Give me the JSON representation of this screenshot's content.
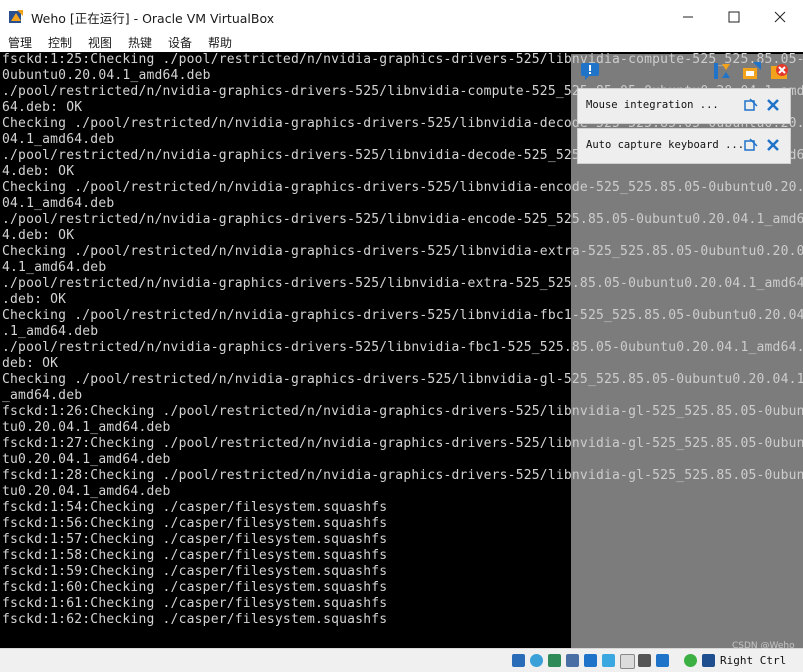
{
  "window": {
    "title": "Weho [正在运行] - Oracle VM VirtualBox",
    "app_icon": "virtualbox-icon",
    "controls": [
      "minimize-icon",
      "maximize-icon",
      "close-icon"
    ]
  },
  "menu": [
    "管理",
    "控制",
    "视图",
    "热键",
    "设备",
    "帮助"
  ],
  "console": {
    "lines": [
      "fsckd:1:25:Checking ./pool/restricted/n/nvidia-graphics-drivers-525/libnvidia-compute-525_525.85.05-",
      "0ubuntu0.20.04.1_amd64.deb",
      "./pool/restricted/n/nvidia-graphics-drivers-525/libnvidia-compute-525_525.85.05-0ubuntu0.20.04.1_amd",
      "64.deb: OK",
      "Checking ./pool/restricted/n/nvidia-graphics-drivers-525/libnvidia-decode-525_525.85.05-0ubuntu0.20.",
      "04.1_amd64.deb",
      "./pool/restricted/n/nvidia-graphics-drivers-525/libnvidia-decode-525_525.85.05-0ubuntu0.20.04.1_amd6",
      "4.deb: OK",
      "Checking ./pool/restricted/n/nvidia-graphics-drivers-525/libnvidia-encode-525_525.85.05-0ubuntu0.20.",
      "04.1_amd64.deb",
      "./pool/restricted/n/nvidia-graphics-drivers-525/libnvidia-encode-525_525.85.05-0ubuntu0.20.04.1_amd6",
      "4.deb: OK",
      "Checking ./pool/restricted/n/nvidia-graphics-drivers-525/libnvidia-extra-525_525.85.05-0ubuntu0.20.0",
      "4.1_amd64.deb",
      "./pool/restricted/n/nvidia-graphics-drivers-525/libnvidia-extra-525_525.85.05-0ubuntu0.20.04.1_amd64",
      ".deb: OK",
      "Checking ./pool/restricted/n/nvidia-graphics-drivers-525/libnvidia-fbc1-525_525.85.05-0ubuntu0.20.04",
      ".1_amd64.deb",
      "./pool/restricted/n/nvidia-graphics-drivers-525/libnvidia-fbc1-525_525.85.05-0ubuntu0.20.04.1_amd64.",
      "deb: OK",
      "Checking ./pool/restricted/n/nvidia-graphics-drivers-525/libnvidia-gl-525_525.85.05-0ubuntu0.20.04.1",
      "_amd64.deb",
      "fsckd:1:26:Checking ./pool/restricted/n/nvidia-graphics-drivers-525/libnvidia-gl-525_525.85.05-0ubun",
      "tu0.20.04.1_amd64.deb",
      "fsckd:1:27:Checking ./pool/restricted/n/nvidia-graphics-drivers-525/libnvidia-gl-525_525.85.05-0ubun",
      "tu0.20.04.1_amd64.deb",
      "fsckd:1:28:Checking ./pool/restricted/n/nvidia-graphics-drivers-525/libnvidia-gl-525_525.85.05-0ubun",
      "tu0.20.04.1_amd64.deb",
      "fsckd:1:54:Checking ./casper/filesystem.squashfs",
      "fsckd:1:56:Checking ./casper/filesystem.squashfs",
      "fsckd:1:57:Checking ./casper/filesystem.squashfs",
      "fsckd:1:58:Checking ./casper/filesystem.squashfs",
      "fsckd:1:59:Checking ./casper/filesystem.squashfs",
      "fsckd:1:60:Checking ./casper/filesystem.squashfs",
      "fsckd:1:61:Checking ./casper/filesystem.squashfs",
      "fsckd:1:62:Checking ./casper/filesystem.squashfs"
    ]
  },
  "notifications": {
    "items": [
      {
        "text": "Mouse integration ...",
        "icons": [
          "toggle-icon",
          "dismiss-icon"
        ]
      },
      {
        "text": "Auto capture keyboard ...",
        "icons": [
          "toggle-icon",
          "dismiss-icon"
        ]
      }
    ],
    "header_icons": [
      "message-icon",
      "collapse-all-icon",
      "settings-icon",
      "close-all-icon"
    ]
  },
  "status_bar": {
    "icons": [
      "hard-disk-icon",
      "optical-drive-icon",
      "audio-icon",
      "network-icon",
      "usb-icon",
      "shared-folder-icon",
      "display-icon",
      "recording-icon",
      "cpu-icon",
      "mouse-integration-icon",
      "keyboard-capture-icon"
    ],
    "host_key": "Right Ctrl",
    "watermark": "CSDN @Weho"
  },
  "colors": {
    "console_bg": "#000000",
    "console_fg": "#d4d4d4",
    "overlay": "#c8c8c8",
    "accent_blue": "#1f73c8"
  }
}
